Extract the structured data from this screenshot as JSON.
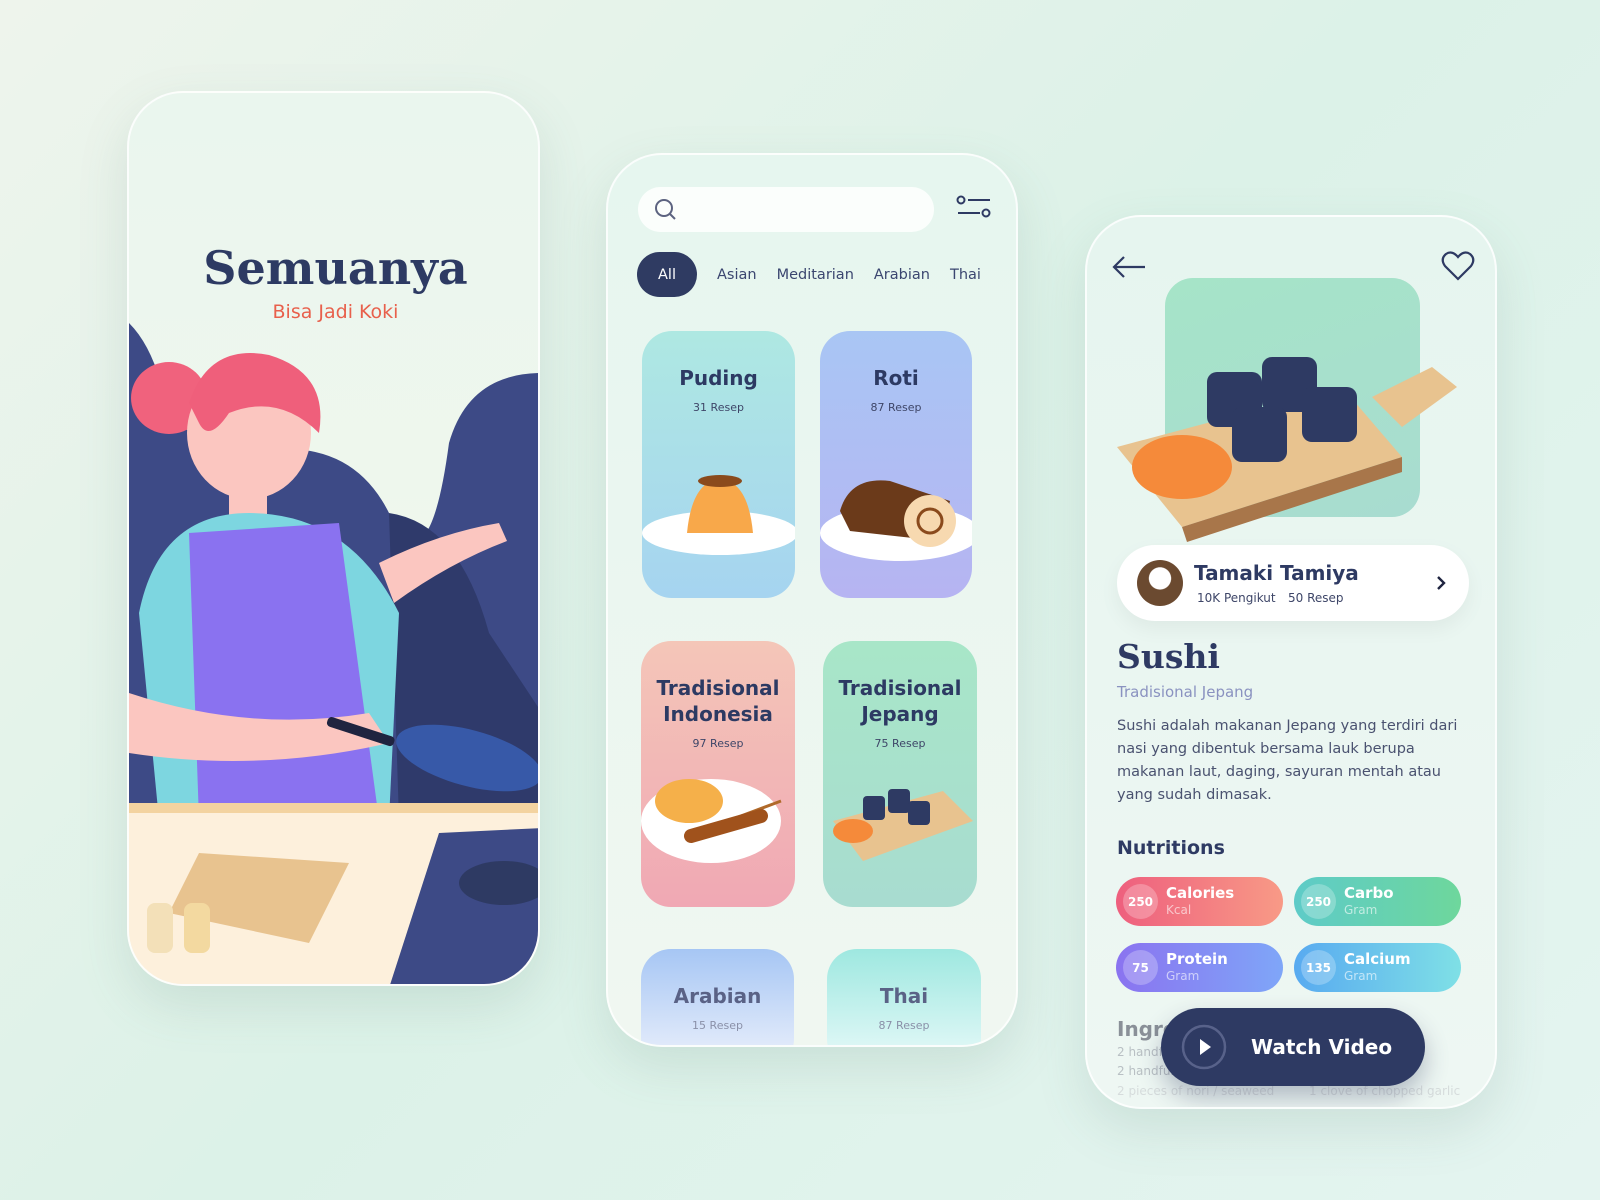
{
  "splash": {
    "title": "Semuanya",
    "subtitle": "Bisa Jadi Koki"
  },
  "browse": {
    "search": {
      "placeholder": "",
      "icon": "search-icon"
    },
    "filter_icon": "sliders-icon",
    "tabs": [
      {
        "label": "All",
        "active": true
      },
      {
        "label": "Asian"
      },
      {
        "label": "Meditarian"
      },
      {
        "label": "Arabian"
      },
      {
        "label": "Thai"
      }
    ],
    "cards": [
      {
        "title": "Puding",
        "count": "31 Resep"
      },
      {
        "title": "Roti",
        "count": "87 Resep"
      },
      {
        "title": "Tradisional Indonesia",
        "count": "97 Resep"
      },
      {
        "title": "Tradisional Jepang",
        "count": "75 Resep"
      },
      {
        "title": "Arabian",
        "count": "15 Resep"
      },
      {
        "title": "Thai",
        "count": "87 Resep"
      }
    ]
  },
  "detail": {
    "chef": {
      "name": "Tamaki Tamiya",
      "followers": "10K Pengikut",
      "recipes": "50 Resep"
    },
    "title": "Sushi",
    "subtitle": "Tradisional Jepang",
    "description": "Sushi adalah makanan Jepang yang terdiri dari nasi yang dibentuk bersama lauk  berupa makanan laut, daging, sayuran mentah atau yang sudah dimasak.",
    "nutritions_label": "Nutritions",
    "nutritions": [
      {
        "value": "250",
        "label": "Calories",
        "unit": "Kcal",
        "colors": [
          "#ee5f7e",
          "#f89a86"
        ]
      },
      {
        "value": "250",
        "label": "Carbo",
        "unit": "Gram",
        "colors": [
          "#5ecbc8",
          "#6ed79c"
        ]
      },
      {
        "value": "75",
        "label": "Protein",
        "unit": "Gram",
        "colors": [
          "#8a73f0",
          "#7fa6f8"
        ]
      },
      {
        "value": "135",
        "label": "Calcium",
        "unit": "Gram",
        "colors": [
          "#58aaf0",
          "#7fe0e6"
        ]
      }
    ],
    "ingredients_label": "Ingredients",
    "ingredients": [
      "2 handfuls",
      "2 handfuls",
      "2 pieces of nori / seaweed",
      "1 clove of chopped garlic"
    ],
    "watch_label": "Watch Video"
  },
  "colors": {
    "primary": "#2e3a63",
    "accent": "#e8604c"
  }
}
